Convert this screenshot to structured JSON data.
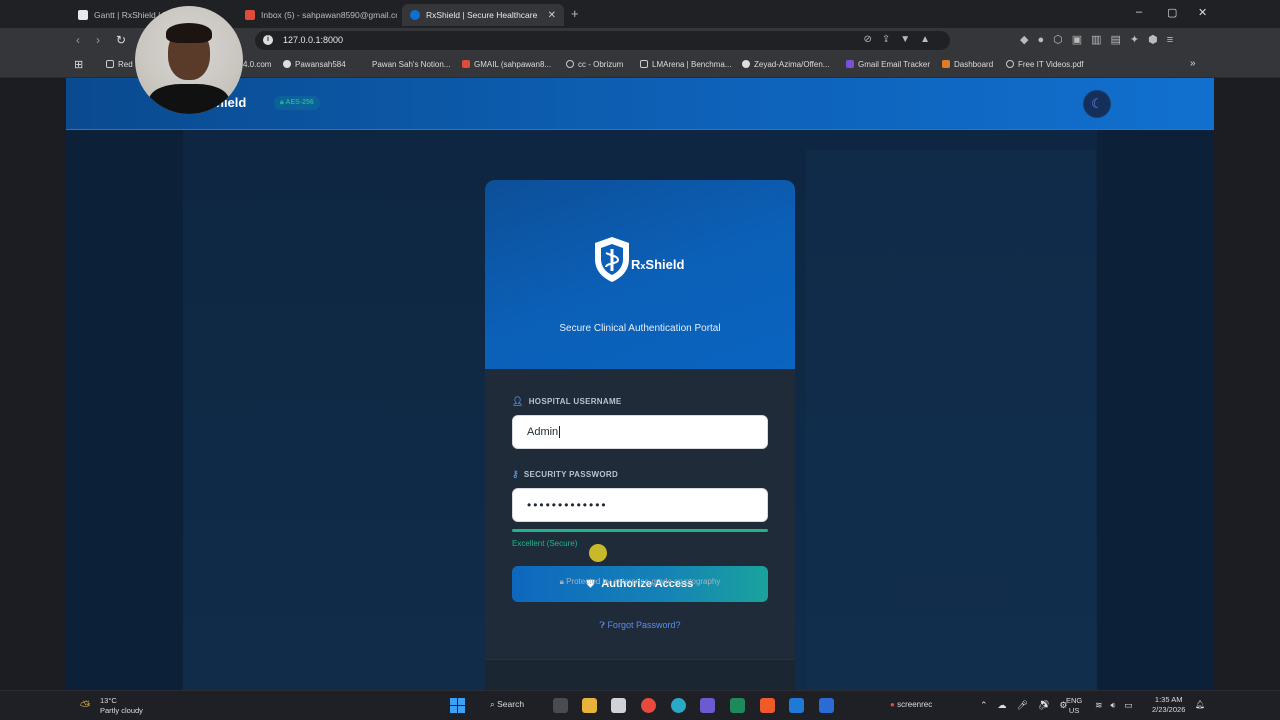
{
  "browser": {
    "tabs": [
      {
        "title": "Gantt | RxShield | P",
        "active": false
      },
      {
        "title": "Inbox (5) - sahpawan8590@gmail.co",
        "active": false
      },
      {
        "title": "RxShield | Secure Healthcare Po",
        "active": true
      }
    ],
    "new_tab": "+",
    "window_controls": {
      "minimize": "–",
      "maximize": "▢",
      "close": "✕"
    },
    "url": "127.0.0.1:8000",
    "bookmarks": [
      "Red",
      "4.0.com",
      "Pawansah584",
      "Pawan Sah's Notion...",
      "GMAIL (sahpawan8...",
      "cc - Obrizum",
      "LMArena | Benchma...",
      "Zeyad-Azima/Offen...",
      "Gmail Email Tracker",
      "Dashboard",
      "Free IT Videos.pdf"
    ],
    "bookmarks_more": "»"
  },
  "header": {
    "brand": "hield",
    "badge": "AES-256",
    "theme_toggle_icon": "☾"
  },
  "login": {
    "logo_text": "R",
    "logo_sub": "x",
    "logo_rest": "Shield",
    "tagline": "Secure Clinical Authentication Portal",
    "username_label": "HOSPITAL USERNAME",
    "username_value": "Admin",
    "password_label": "SECURITY PASSWORD",
    "password_value": "•••••••••••••",
    "strength_percent": 100,
    "strength_text": "Excellent (Secure)",
    "submit_label": "Authorize Access",
    "forgot_label": "Forgot Password?",
    "footer_note": "Protected by enterprise-grade cryptography"
  },
  "taskbar": {
    "weather_temp": "13°C",
    "weather_desc": "Partly cloudy",
    "search_label": "Search",
    "tray_app": "screenrec",
    "language": "ENG",
    "region": "US",
    "time": "1:35 AM",
    "date": "2/23/2026"
  },
  "colors": {
    "header_blue": "#0d5fb4",
    "success_green": "#1fb48a",
    "link_blue": "#5a8df0"
  }
}
